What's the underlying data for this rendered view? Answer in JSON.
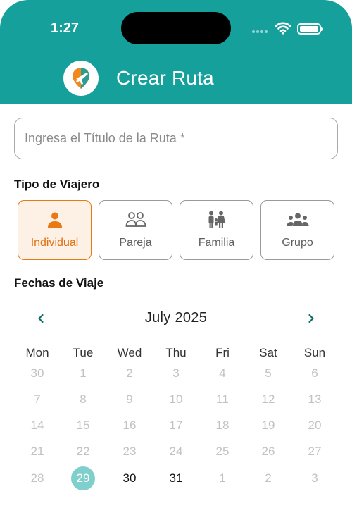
{
  "status_bar": {
    "time": "1:27"
  },
  "header": {
    "title": "Crear Ruta",
    "logo_icon": "map-pin-plane-icon"
  },
  "route_title": {
    "placeholder": "Ingresa el Título de la Ruta *",
    "value": ""
  },
  "traveler_type": {
    "label": "Tipo de Viajero",
    "options": [
      {
        "label": "Individual",
        "icon": "person-icon",
        "selected": true
      },
      {
        "label": "Pareja",
        "icon": "couple-icon",
        "selected": false
      },
      {
        "label": "Familia",
        "icon": "family-icon",
        "selected": false
      },
      {
        "label": "Grupo",
        "icon": "group-icon",
        "selected": false
      }
    ]
  },
  "dates": {
    "label": "Fechas de Viaje",
    "month_label": "July 2025",
    "prev_icon": "chevron-left-icon",
    "next_icon": "chevron-right-icon",
    "weekdays": [
      "Mon",
      "Tue",
      "Wed",
      "Thu",
      "Fri",
      "Sat",
      "Sun"
    ],
    "weeks": [
      [
        "30",
        "1",
        "2",
        "3",
        "4",
        "5",
        "6"
      ],
      [
        "7",
        "8",
        "9",
        "10",
        "11",
        "12",
        "13"
      ],
      [
        "14",
        "15",
        "16",
        "17",
        "18",
        "19",
        "20"
      ],
      [
        "21",
        "22",
        "23",
        "24",
        "25",
        "26",
        "27"
      ],
      [
        "28",
        "29",
        "30",
        "31",
        "1",
        "2",
        "3"
      ]
    ],
    "today": "29",
    "active_days": [
      "30",
      "31"
    ]
  },
  "colors": {
    "header": "#16a09c",
    "accent": "#e87a16",
    "selected_bg": "#fdf0e4",
    "today": "#7fcfcc",
    "nav": "#0f6e6a"
  }
}
